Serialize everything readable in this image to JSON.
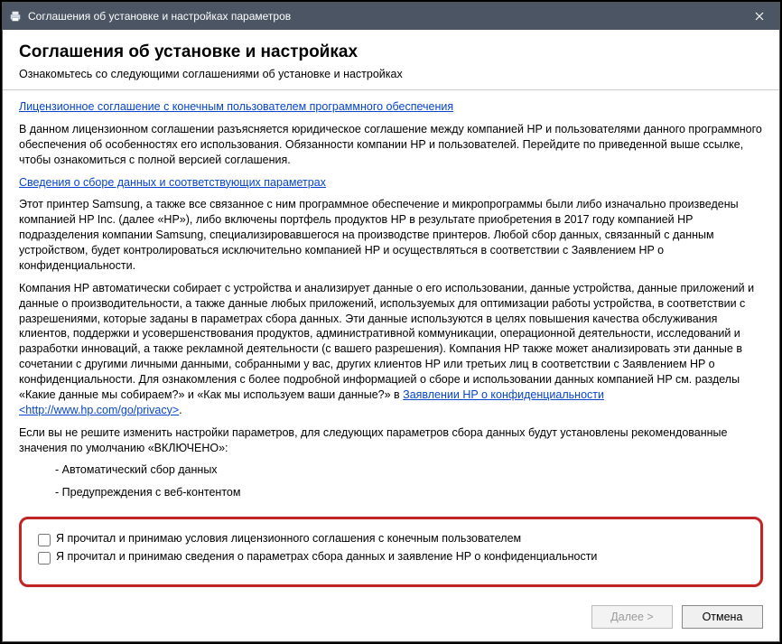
{
  "titlebar": {
    "title": "Соглашения об установке и настройках параметров"
  },
  "header": {
    "heading": "Соглашения об установке и настройках",
    "sub": "Ознакомьтесь со следующими соглашениями об установке и настройках"
  },
  "body": {
    "link1": "Лицензионное соглашение с конечным пользователем программного обеспечения",
    "p1": "В данном лицензионном соглашении разъясняется юридическое соглашение между компанией HP и пользователями данного программного обеспечения об особенностях его использования. Обязанности компании HP и пользователей. Перейдите по приведенной выше ссылке, чтобы ознакомиться с полной версией соглашения.",
    "link2": "Сведения о сборе данных и соответствующих параметрах",
    "p2": "Этот принтер Samsung, а также все связанное с ним программное обеспечение и микропрограммы были либо изначально произведены компанией HP Inc. (далее «HP»), либо включены портфель продуктов HP в результате приобретения в 2017 году компанией HP подразделения компании Samsung, специализировавшегося на производстве принтеров.  Любой сбор данных, связанный с данным устройством, будет контролироваться исключительно компанией HP и осуществляться в соответствии с Заявлением HP о конфиденциальности.",
    "p3_a": "Компания HP автоматически собирает с устройства и анализирует данные о его использовании, данные устройства, данные приложений и данные о производительности, а также данные любых приложений, используемых для оптимизации работы устройства, в соответствии с разрешениями, которые заданы в параметрах сбора данных.  Эти данные используются в целях повышения качества обслуживания клиентов, поддержки и усовершенствования продуктов, административной коммуникации, операционной деятельности, исследований и разработки инноваций, а также рекламной деятельности (с вашего разрешения). Компания HP также может анализировать эти данные в сочетании с другими личными данными, собранными у вас, других клиентов HP или третьих лиц в соответствии с Заявлением HP о конфиденциальности. Для ознакомления с более подробной информацией о сборе и использовании данных компанией HP см. разделы «Какие данные мы собираем?» и «Как мы используем ваши данные?» в ",
    "link3": "Заявлении HP о конфиденциальности <http://www.hp.com/go/privacy>",
    "p3_b": ".",
    "p4": "Если вы не решите изменить настройки параметров, для следующих параметров сбора данных будут установлены рекомендованные значения по умолчанию «ВКЛЮЧЕНО»:",
    "bullet1": "- Автоматический сбор данных",
    "bullet2": "- Предупреждения с веб-контентом"
  },
  "checks": {
    "c1": "Я прочитал и принимаю условия лицензионного соглашения с конечным пользователем",
    "c2": "Я прочитал и принимаю сведения о параметрах сбора данных и заявление HP о конфиденциальности"
  },
  "footer": {
    "next": "Далее >",
    "cancel": "Отмена"
  }
}
